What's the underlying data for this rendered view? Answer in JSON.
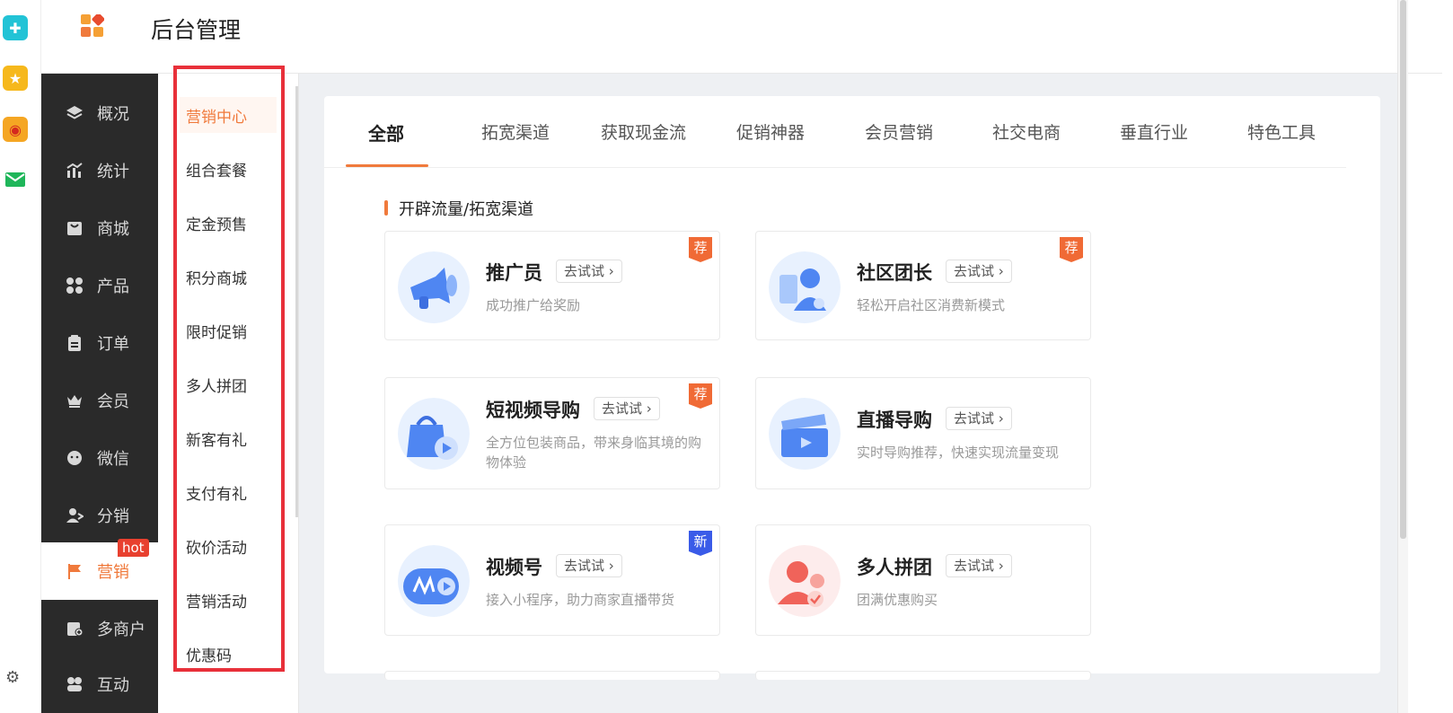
{
  "app": {
    "title": "后台管理"
  },
  "sidebar": {
    "items": [
      {
        "label": "概况",
        "icon": "layers-icon"
      },
      {
        "label": "统计",
        "icon": "chart-icon"
      },
      {
        "label": "商城",
        "icon": "store-icon"
      },
      {
        "label": "产品",
        "icon": "grid-icon"
      },
      {
        "label": "订单",
        "icon": "order-icon"
      },
      {
        "label": "会员",
        "icon": "crown-icon"
      },
      {
        "label": "微信",
        "icon": "wechat-icon"
      },
      {
        "label": "分销",
        "icon": "user-share-icon"
      },
      {
        "label": "营销",
        "icon": "flag-icon",
        "active": true
      },
      {
        "label": "多商户",
        "icon": "merchant-icon"
      },
      {
        "label": "互动",
        "icon": "interact-icon"
      }
    ],
    "hot_badge": "hot"
  },
  "subnav": {
    "items": [
      "营销中心",
      "组合套餐",
      "定金预售",
      "积分商城",
      "限时促销",
      "多人拼团",
      "新客有礼",
      "支付有礼",
      "砍价活动",
      "营销活动",
      "优惠码"
    ],
    "active_index": 0
  },
  "tabs": [
    "全部",
    "拓宽渠道",
    "获取现金流",
    "促销神器",
    "会员营销",
    "社交电商",
    "垂直行业",
    "特色工具"
  ],
  "section": {
    "title": "开辟流量/拓宽渠道"
  },
  "cards": [
    {
      "title": "推广员",
      "try": "去试试",
      "desc": "成功推广给奖励",
      "badge": "荐",
      "badge_color": "#f06a35",
      "icon": "megaphone-icon"
    },
    {
      "title": "社区团长",
      "try": "去试试",
      "desc": "轻松开启社区消费新模式",
      "badge": "荐",
      "badge_color": "#f06a35",
      "icon": "community-leader-icon"
    },
    {
      "title": "短视频导购",
      "try": "去试试",
      "desc": "全方位包装商品，带来身临其境的购物体验",
      "badge": "荐",
      "badge_color": "#f06a35",
      "icon": "shopping-bag-video-icon"
    },
    {
      "title": "直播导购",
      "try": "去试试",
      "desc": "实时导购推荐，快速实现流量变现",
      "badge": "",
      "icon": "clapperboard-icon"
    },
    {
      "title": "视频号",
      "try": "去试试",
      "desc": "接入小程序，助力商家直播带货",
      "badge": "新",
      "badge_color": "#3a5be8",
      "icon": "video-channel-icon"
    },
    {
      "title": "多人拼团",
      "try": "去试试",
      "desc": "团满优惠购买",
      "badge": "",
      "icon": "group-buy-icon"
    }
  ],
  "colors": {
    "accent": "#f07a3c",
    "sidebar_bg": "#2a2a2a",
    "frame": "#e8303a"
  }
}
